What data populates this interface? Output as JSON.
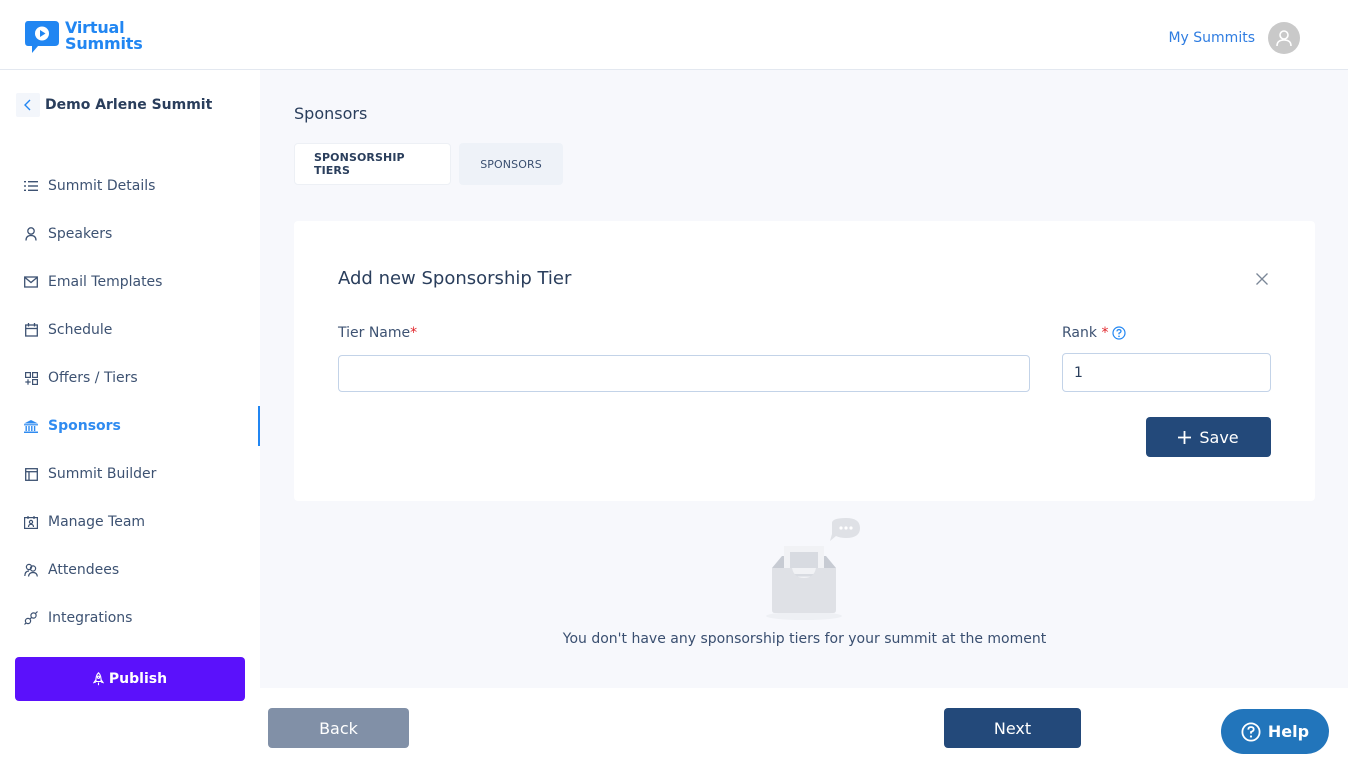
{
  "header": {
    "brand_line1": "Virtual",
    "brand_line2": "Summits",
    "brand_color": "#2186f2",
    "my_summits_label": "My Summits",
    "avatar_icon": "user-icon"
  },
  "sidebar": {
    "summit_name": "Demo Arlene Summit",
    "back_icon": "chevron-left-icon",
    "items": [
      {
        "label": "Summit Details",
        "icon": "list-icon",
        "active": false
      },
      {
        "label": "Speakers",
        "icon": "user-icon",
        "active": false
      },
      {
        "label": "Email Templates",
        "icon": "mail-icon",
        "active": false
      },
      {
        "label": "Schedule",
        "icon": "calendar-icon",
        "active": false
      },
      {
        "label": "Offers / Tiers",
        "icon": "grid-plus-icon",
        "active": false
      },
      {
        "label": "Sponsors",
        "icon": "bank-icon",
        "active": true
      },
      {
        "label": "Summit Builder",
        "icon": "layout-icon",
        "active": false
      },
      {
        "label": "Manage Team",
        "icon": "team-board-icon",
        "active": false
      },
      {
        "label": "Attendees",
        "icon": "users-icon",
        "active": false
      },
      {
        "label": "Integrations",
        "icon": "plug-icon",
        "active": false
      }
    ],
    "publish_label": "Publish",
    "publish_color": "#5b11fb"
  },
  "main": {
    "page_title": "Sponsors",
    "tabs": [
      {
        "label": "SPONSORSHIP TIERS",
        "active": true
      },
      {
        "label": "SPONSORS",
        "active": false
      }
    ],
    "form": {
      "title": "Add new Sponsorship Tier",
      "tier_name_label": "Tier Name",
      "tier_name_value": "",
      "tier_name_placeholder": "",
      "rank_label": "Rank",
      "rank_value": "1",
      "required_marker": "*",
      "save_label": "Save"
    },
    "empty_state": {
      "message": "You don't have any sponsorship tiers for your summit at the moment"
    }
  },
  "footer": {
    "back_label": "Back",
    "next_label": "Next",
    "help_label": "Help"
  }
}
